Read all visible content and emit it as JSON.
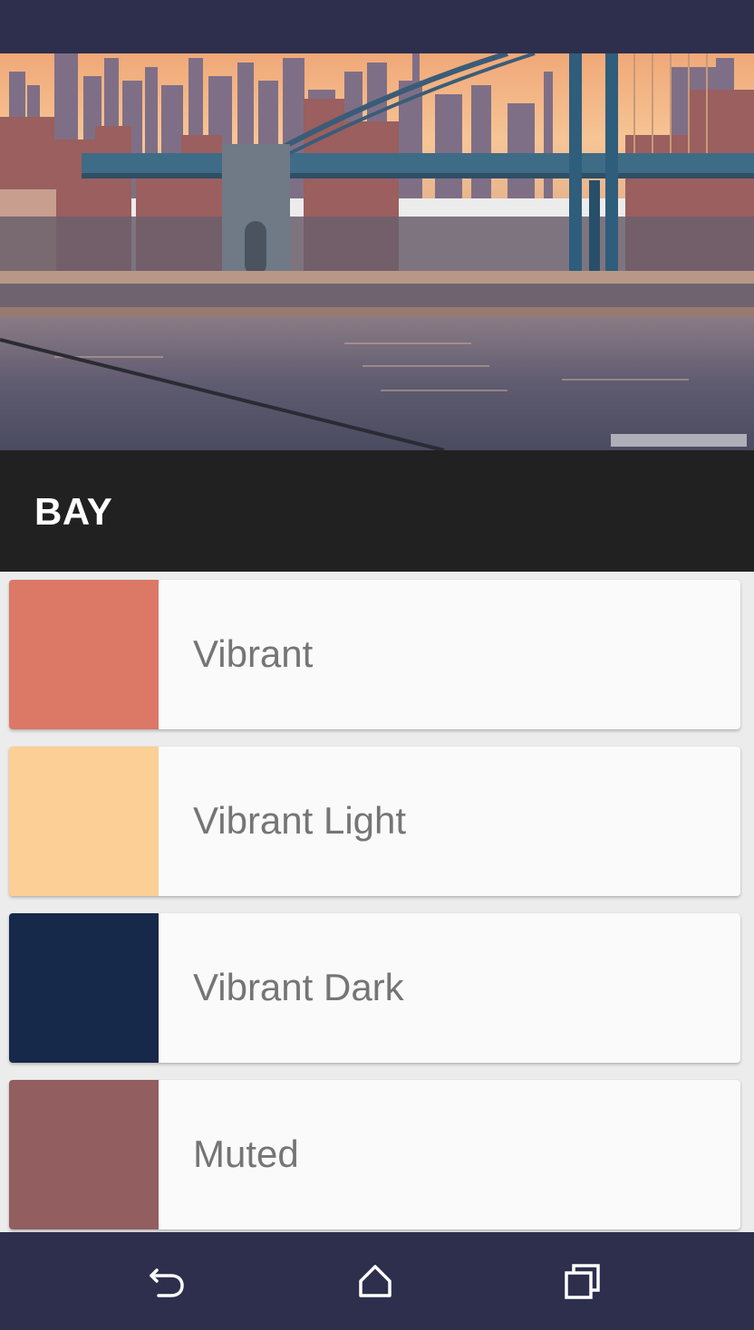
{
  "colors": {
    "status_bar": "#2d2f4d",
    "title_bar": "#212121",
    "nav_bar": "#2d2f4d",
    "card_background": "#fafafa",
    "label_text": "#757575"
  },
  "header": {
    "image_name": "manhattan-bridge-skyline-photo",
    "title": "BAY"
  },
  "swatches": [
    {
      "label": "Vibrant",
      "color": "#dc7866"
    },
    {
      "label": "Vibrant Light",
      "color": "#fbcf95"
    },
    {
      "label": "Vibrant Dark",
      "color": "#17294a"
    },
    {
      "label": "Muted",
      "color": "#925e5f"
    }
  ],
  "navigation": {
    "back_icon": "back-icon",
    "home_icon": "home-icon",
    "recents_icon": "recents-icon"
  }
}
